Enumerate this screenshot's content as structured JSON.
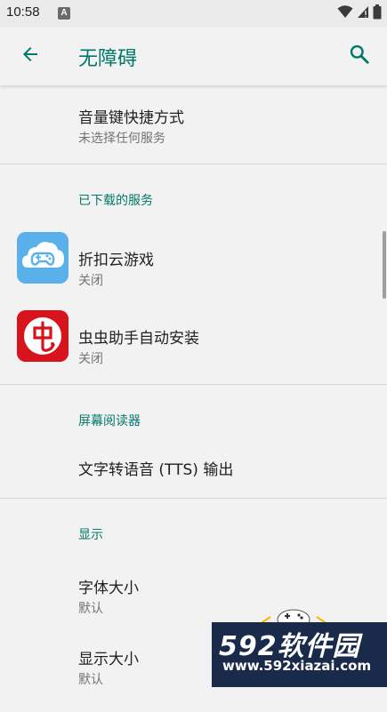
{
  "status_bar": {
    "time": "10:58",
    "notification_icon_letter": "A",
    "icons": [
      "wifi-icon",
      "signal-icon",
      "battery-icon"
    ]
  },
  "app_bar": {
    "title": "无障碍",
    "back_icon": "arrow-left-icon",
    "search_icon": "search-icon"
  },
  "colors": {
    "accent": "#00796b",
    "background": "#f2f2f2",
    "divider": "#d6d6d6",
    "summary": "#737373"
  },
  "volume_shortcut": {
    "title": "音量键快捷方式",
    "summary": "未选择任何服务"
  },
  "downloaded_services": {
    "header": "已下载的服务",
    "items": [
      {
        "title": "折扣云游戏",
        "summary": "关闭",
        "icon": "cloud-gamepad-icon"
      },
      {
        "title": "虫虫助手自动安装",
        "summary": "关闭",
        "icon": "chongchong-icon"
      }
    ]
  },
  "screen_reader": {
    "header": "屏幕阅读器",
    "tts_title": "文字转语音 (TTS) 输出"
  },
  "display": {
    "header": "显示",
    "font_size": {
      "title": "字体大小",
      "summary": "默认"
    },
    "display_size": {
      "title": "显示大小",
      "summary": "默认"
    }
  },
  "watermark": {
    "logo": "592软件园",
    "url": "www.592xiazai.com"
  }
}
